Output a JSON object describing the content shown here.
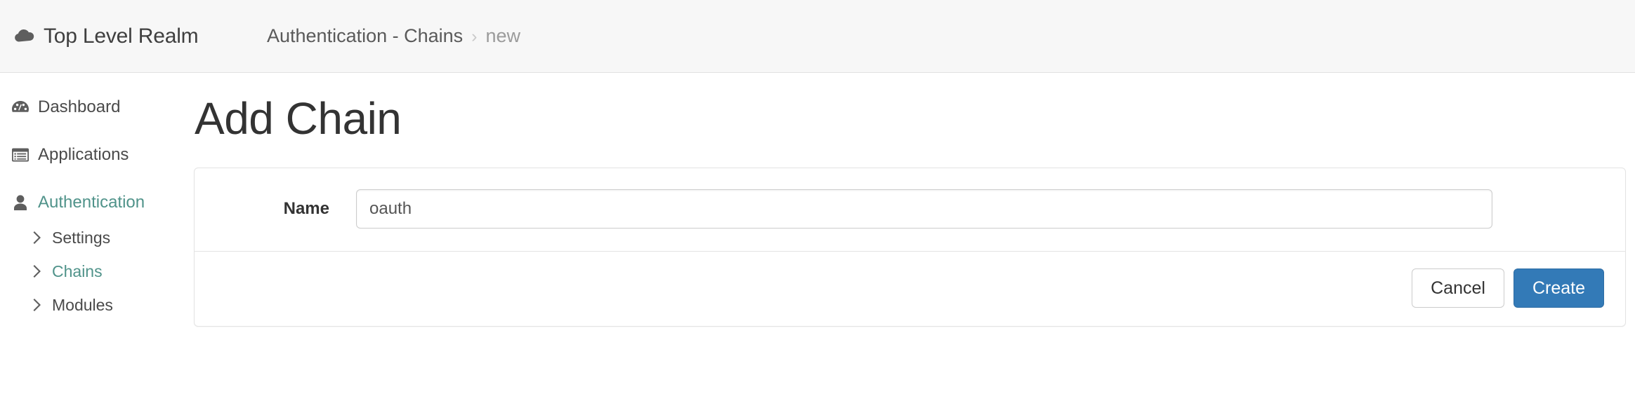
{
  "header": {
    "brand": {
      "icon": "cloud-icon",
      "label": "Top Level Realm"
    },
    "breadcrumb": {
      "parent": "Authentication - Chains",
      "separator": "›",
      "current": "new"
    }
  },
  "sidebar": {
    "items": [
      {
        "icon": "dashboard-gauge-icon",
        "label": "Dashboard",
        "active": false
      },
      {
        "icon": "applications-window-icon",
        "label": "Applications",
        "active": false
      },
      {
        "icon": "authentication-user-icon",
        "label": "Authentication",
        "active": true
      }
    ],
    "subitems": [
      {
        "icon": "chevron-right-icon",
        "label": "Settings",
        "active": false
      },
      {
        "icon": "chevron-right-icon",
        "label": "Chains",
        "active": true
      },
      {
        "icon": "chevron-right-icon",
        "label": "Modules",
        "active": false
      }
    ]
  },
  "main": {
    "title": "Add Chain",
    "form": {
      "name_label": "Name",
      "name_value": "oauth",
      "name_placeholder": ""
    },
    "footer": {
      "cancel_label": "Cancel",
      "create_label": "Create"
    }
  },
  "colors": {
    "accent_teal": "#50938a",
    "primary_blue": "#337ab7",
    "header_bg": "#f7f7f7",
    "border": "#e3e3e3",
    "muted_text": "#9b9b9b"
  }
}
